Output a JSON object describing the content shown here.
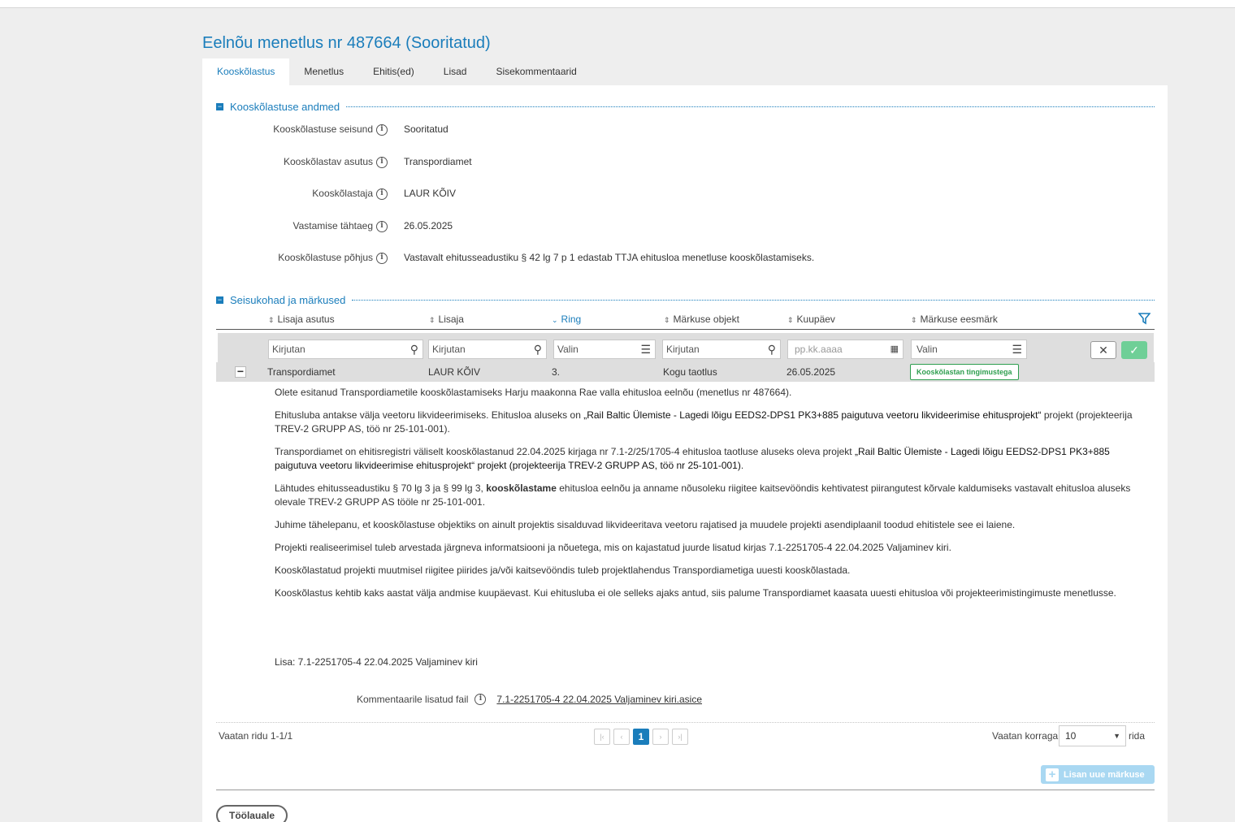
{
  "page": {
    "title": "Eelnõu menetlus nr 487664 (Sooritatud)"
  },
  "tabs": [
    {
      "label": "Kooskõlastus",
      "active": true
    },
    {
      "label": "Menetlus"
    },
    {
      "label": "Ehitis(ed)"
    },
    {
      "label": "Lisad"
    },
    {
      "label": "Sisekommentaarid"
    }
  ],
  "section1": {
    "title": "Kooskõlastuse andmed",
    "fields": [
      {
        "label": "Kooskõlastuse seisund",
        "value": "Sooritatud"
      },
      {
        "label": "Kooskõlastav asutus",
        "value": "Transpordiamet"
      },
      {
        "label": "Kooskõlastaja",
        "value": "LAUR KÕIV"
      },
      {
        "label": "Vastamise tähtaeg",
        "value": "26.05.2025"
      },
      {
        "label": "Kooskõlastuse põhjus",
        "value": "Vastavalt ehitusseadustiku § 42 lg 7 p 1 edastab TTJA ehitusloa menetluse kooskõlastamiseks."
      }
    ]
  },
  "section2": {
    "title": "Seisukohad ja märkused",
    "columns": [
      "Lisaja asutus",
      "Lisaja",
      "Ring",
      "Märkuse objekt",
      "Kuupäev",
      "Märkuse eesmärk"
    ],
    "filters": {
      "lisaja_asutus": "Kirjutan",
      "lisaja": "Kirjutan",
      "ring": "Valin",
      "objekt": "Kirjutan",
      "kuupaev": "pp.kk.aaaa",
      "eesmark": "Valin"
    },
    "row": {
      "asutus": "Transpordiamet",
      "lisaja": "LAUR KÕIV",
      "ring": "3.",
      "objekt": "Kogu taotlus",
      "kuupaev": "26.05.2025",
      "eesmark": "Kooskõlastan tingimustega"
    },
    "paragraphs": {
      "p1": "Olete esitanud Transpordiametile kooskõlastamiseks Harju maakonna Rae valla ehitusloa eelnõu (menetlus nr 487664).",
      "p2a": "Ehitusluba antakse välja veetoru likvideerimiseks. Ehitusloa aluseks on ",
      "p2b": "„Rail Baltic Ülemiste - Lagedi lõigu EEDS2-DPS1 PK3+885 paigutuva veetoru likvideerimise ehitusprojekt“",
      "p2c": " projekt (projekteerija TREV-2 GRUPP AS, töö nr 25-101-001).",
      "p3a": "Transpordiamet on ehitisregistri väliselt kooskõlastanud 22.04.2025 kirjaga nr 7.1-2/25/1705-4 ehitusloa taotluse aluseks oleva projekt ",
      "p3b": "„Rail Baltic Ülemiste - Lagedi lõigu EEDS2-DPS1 PK3+885 paigutuva veetoru likvideerimise ehitusprojekt“ projekt (projekteerija TREV-2 GRUPP AS, töö nr 25-101-001)",
      "p3c": ".",
      "p4a": "Lähtudes ehitusseadustiku § 70 lg 3 ja § 99 lg 3, ",
      "p4b": "kooskõlastame",
      "p4c": " ehitusloa eelnõu ja anname nõusoleku riigitee kaitsevööndis kehtivatest piirangutest kõrvale kaldumiseks vastavalt ehitusloa aluseks olevale TREV-2 GRUPP AS tööle nr 25-101-001.",
      "p5": "Juhime tähelepanu, et kooskõlastuse objektiks on ainult projektis sisalduvad likvideeritava veetoru rajatised ja muudele projekti asendiplaanil toodud ehitistele see ei laiene.",
      "p6": "Projekti realiseerimisel tuleb arvestada järgneva informatsiooni ja nõuetega, mis on kajastatud juurde lisatud kirjas 7.1-2251705-4 22.04.2025 Valjaminev kiri.",
      "p7": "Kooskõlastatud projekti muutmisel riigitee piirides ja/või kaitsevööndis tuleb projektlahendus Transpordiametiga uuesti kooskõlastada.",
      "p8": "Kooskõlastus kehtib kaks aastat välja andmise kuupäevast. Kui ehitusluba ei ole selleks ajaks antud, siis palume Transpordiamet kaasata uuesti ehitusloa või projekteerimistingimuste menetlusse."
    },
    "lisa": "Lisa: 7.1-2251705-4 22.04.2025 Valjaminev kiri",
    "attachment_label": "Kommentaarile lisatud fail",
    "attachment_file": "7.1-2251705-4 22.04.2025 Valjaminev kiri.asice",
    "pagination": {
      "info": "Vaatan ridu 1-1/1",
      "current": "1",
      "per_page_label": "Vaatan korraga",
      "per_page": "10",
      "rows_label": "rida"
    },
    "add_button": "Lisan uue märkuse"
  },
  "back_button": "Töölauale",
  "colors": {
    "accent": "#1a7dbb",
    "success": "#2e9e4f"
  }
}
